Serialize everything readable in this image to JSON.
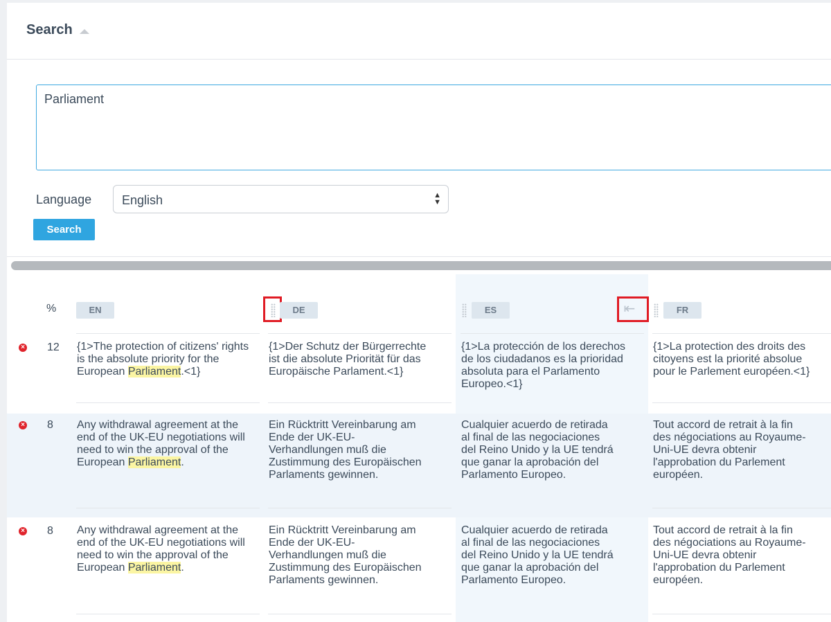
{
  "search": {
    "title": "Search",
    "query": "Parliament",
    "language_label": "Language",
    "language_value": "English",
    "button_label": "Search"
  },
  "table": {
    "pct_header": "%",
    "languages": [
      "EN",
      "DE",
      "ES",
      "FR"
    ],
    "rows": [
      {
        "pct": "12",
        "en_before": "{1>The protection of citizens' rights is the absolute priority for the European ",
        "en_hl": "Parliament",
        "en_after": ".<1}",
        "de": "{1>Der Schutz der Bürgerrechte ist die absolute Priorität für das Europäische Parlament.<1}",
        "es": "{1>La protección de los derechos de los ciudadanos es la prioridad absoluta para el Parlamento Europeo.<1}",
        "fr": "{1>La protection des droits des citoyens est la priorité absolue pour le Parlement européen.<1}"
      },
      {
        "pct": "8",
        "en_before": "Any withdrawal agreement at the end of the UK-EU negotiations will need to win the approval of the European ",
        "en_hl": "Parliament",
        "en_after": ".",
        "de": "Ein Rücktritt Vereinbarung am Ende der UK-EU-Verhandlungen muß die Zustimmung des Europäischen Parlaments gewinnen.",
        "es": "Cualquier acuerdo de retirada al final de las negociaciones del Reino Unido y la UE tendrá que ganar la aprobación del Parlamento Europeo.",
        "fr": "Tout accord de retrait à la fin des négociations au Royaume-Uni-UE devra obtenir l'approbation du Parlement européen."
      },
      {
        "pct": "8",
        "en_before": "Any withdrawal agreement at the end of the UK-EU negotiations will need to win the approval of the European ",
        "en_hl": "Parliament",
        "en_after": ".",
        "de": "Ein Rücktritt Vereinbarung am Ende der UK-EU-Verhandlungen muß die Zustimmung des Europäischen Parlaments gewinnen.",
        "es": "Cualquier acuerdo de retirada al final de las negociaciones del Reino Unido y la UE tendrá que ganar la aprobación del Parlamento Europeo.",
        "fr": "Tout accord de retrait à la fin des négociations au Royaume-Uni-UE devra obtenir l'approbation du Parlement européen."
      }
    ]
  },
  "icons": {
    "delete": "delete-circle-icon",
    "grip": "drag-handle-icon",
    "collapse": "collapse-left-icon"
  },
  "colors": {
    "accent": "#2fa5e0",
    "highlight": "#fbf5a3",
    "delete": "#e0242c",
    "annotation_box": "#e01b24"
  }
}
